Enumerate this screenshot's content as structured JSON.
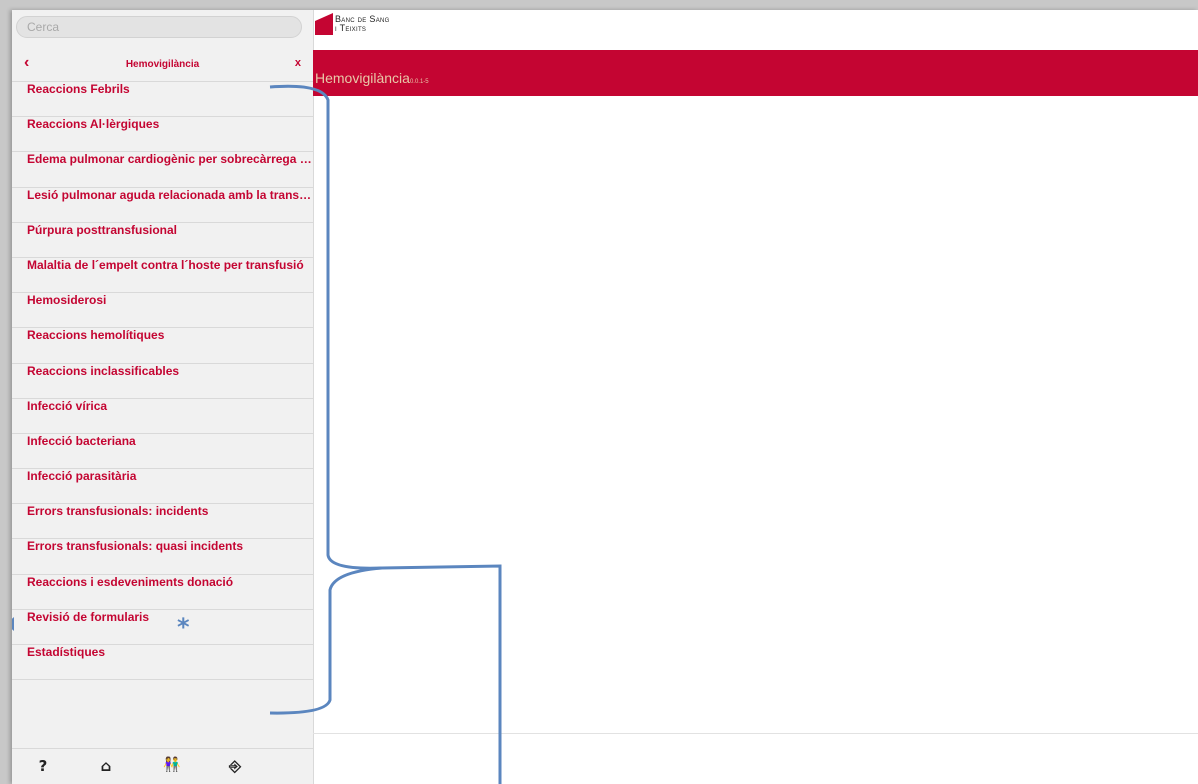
{
  "search": {
    "placeholder": "Cerca"
  },
  "menu": {
    "title": "Hemovigilància",
    "back": "‹",
    "close": "x",
    "items": [
      "Reaccions Febrils",
      "Reaccions Al·lèrgiques",
      "Edema pulmonar cardiogènic per sobrecàrrega vo...",
      "Lesió pulmonar aguda relacionada amb la transfu...",
      "Púrpura posttransfusional",
      "Malaltia de l´empelt contra l´hoste per transfusió",
      "Hemosiderosi",
      "Reaccions hemolítiques",
      "Reaccions inclassificables",
      "Infecció vírica",
      "Infecció bacteriana",
      "Infecció parasitària",
      "Errors transfusionals: incidents",
      "Errors transfusionals: quasi incidents",
      "Reaccions i esdeveniments donació",
      "Revisió de formularis",
      "Estadístiques"
    ]
  },
  "footer_icons": {
    "help": "?",
    "home": "⌂",
    "users": "👫",
    "exit": "⎆"
  },
  "logo": {
    "line1": "Banc de Sang",
    "line2": "i Teixits"
  },
  "header": {
    "title": "Hemovigilància",
    "version": "0.0.1-5"
  },
  "annotation": {
    "asterisk": "*"
  },
  "colors": {
    "brand": "#c40532",
    "annotation": "#5b86bf"
  }
}
